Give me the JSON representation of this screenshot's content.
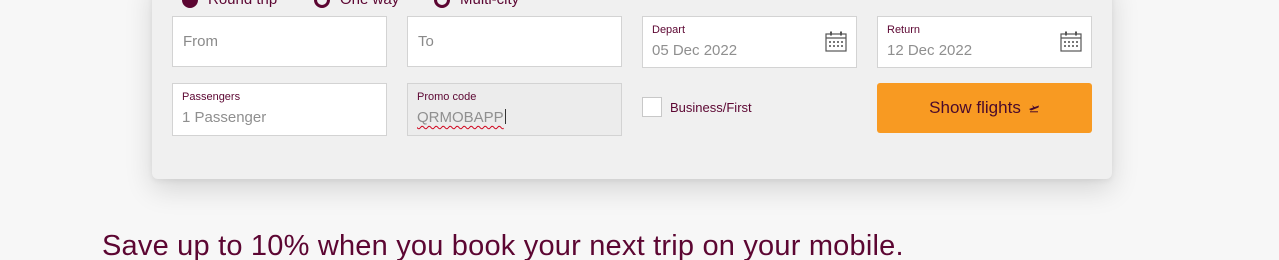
{
  "trip_types": [
    {
      "label": "Round trip",
      "checked": true
    },
    {
      "label": "One way",
      "checked": false
    },
    {
      "label": "Multi-city",
      "checked": false
    }
  ],
  "form": {
    "from_placeholder": "From",
    "to_placeholder": "To",
    "depart": {
      "label": "Depart",
      "value": "05 Dec 2022",
      "icon": "calendar-icon"
    },
    "return": {
      "label": "Return",
      "value": "12 Dec 2022",
      "icon": "calendar-icon"
    },
    "passengers": {
      "label": "Passengers",
      "value": "1 Passenger"
    },
    "promo": {
      "label": "Promo code",
      "value": "QRMOBAPP"
    },
    "business_first_label": "Business/First",
    "business_first_checked": false,
    "submit_label": "Show flights",
    "submit_icon": "plane-icon"
  },
  "banner_text": "Save up to 10% when you book your next trip on your mobile.",
  "colors": {
    "brand": "#5c0632",
    "accent": "#f89a22"
  }
}
